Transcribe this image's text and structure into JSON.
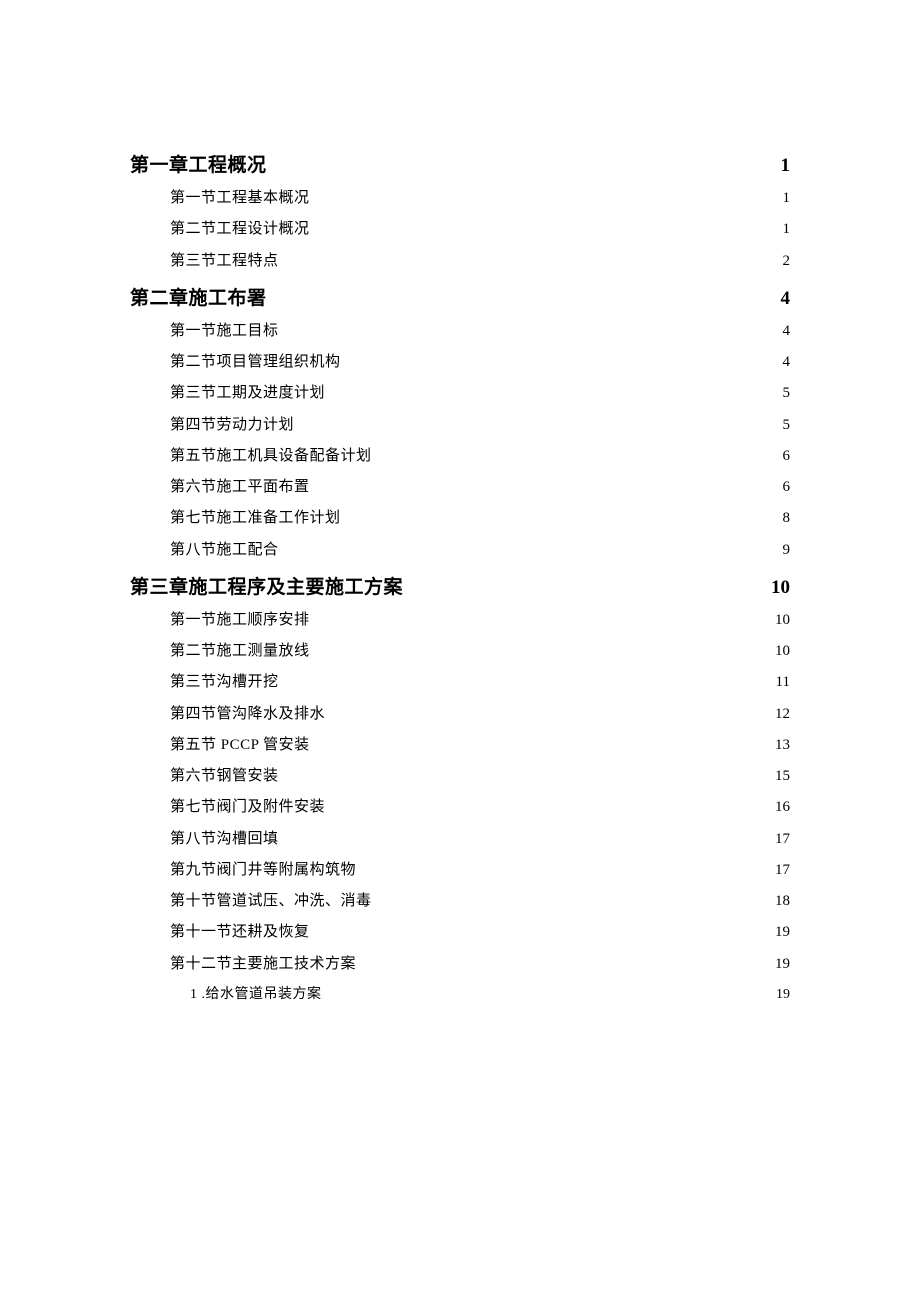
{
  "toc": [
    {
      "level": 1,
      "title": "第一章工程概况",
      "page": "1"
    },
    {
      "level": 2,
      "title": "第一节工程基本概况",
      "page": "1"
    },
    {
      "level": 2,
      "title": "第二节工程设计概况",
      "page": "1"
    },
    {
      "level": 2,
      "title": "第三节工程特点",
      "page": "2"
    },
    {
      "level": 1,
      "title": "第二章施工布署",
      "page": "4"
    },
    {
      "level": 2,
      "title": "第一节施工目标",
      "page": "4"
    },
    {
      "level": 2,
      "title": "第二节项目管理组织机构",
      "page": "4"
    },
    {
      "level": 2,
      "title": "第三节工期及进度计划",
      "page": "5"
    },
    {
      "level": 2,
      "title": "第四节劳动力计划",
      "page": "5"
    },
    {
      "level": 2,
      "title": "第五节施工机具设备配备计划",
      "page": "6"
    },
    {
      "level": 2,
      "title": "第六节施工平面布置",
      "page": "6"
    },
    {
      "level": 2,
      "title": "第七节施工准备工作计划",
      "page": "8"
    },
    {
      "level": 2,
      "title": "第八节施工配合",
      "page": "9"
    },
    {
      "level": 1,
      "title": "第三章施工程序及主要施工方案",
      "page": "10"
    },
    {
      "level": 2,
      "title": "第一节施工顺序安排",
      "page": "10"
    },
    {
      "level": 2,
      "title": "第二节施工测量放线",
      "page": "10"
    },
    {
      "level": 2,
      "title": "第三节沟槽开挖",
      "page": "11"
    },
    {
      "level": 2,
      "title": "第四节管沟降水及排水",
      "page": "12"
    },
    {
      "level": 2,
      "title": "第五节 PCCP 管安装",
      "page": "13"
    },
    {
      "level": 2,
      "title": "第六节钢管安装",
      "page": "15"
    },
    {
      "level": 2,
      "title": "第七节阀门及附件安装",
      "page": "16"
    },
    {
      "level": 2,
      "title": "第八节沟槽回填",
      "page": "17"
    },
    {
      "level": 2,
      "title": "第九节阀门井等附属构筑物",
      "page": "17"
    },
    {
      "level": 2,
      "title": "第十节管道试压、冲洗、消毒",
      "page": "18"
    },
    {
      "level": 2,
      "title": "第十一节还耕及恢复",
      "page": "19"
    },
    {
      "level": 2,
      "title": "第十二节主要施工技术方案",
      "page": "19"
    },
    {
      "level": 3,
      "title": "1 .给水管道吊装方案",
      "page": "19"
    }
  ]
}
